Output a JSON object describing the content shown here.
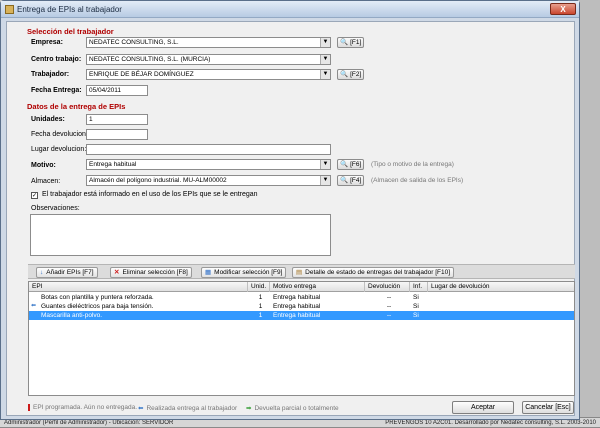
{
  "window": {
    "title": "Entrega de EPIs al trabajador",
    "close_label": "X"
  },
  "trabajador_section": {
    "title": "Selección del trabajador",
    "empresa_label": "Empresa:",
    "empresa_value": "NEDATEC CONSULTING, S.L.",
    "empresa_key": "[F1]",
    "centro_label": "Centro trabajo:",
    "centro_value": "NEDATEC CONSULTING, S.L. (MURCIA)",
    "trabajador_label": "Trabajador:",
    "trabajador_value": "ENRIQUE DE BÉJAR DOMÍNGUEZ",
    "trabajador_key": "[F2]",
    "fecha_label": "Fecha Entrega:",
    "fecha_value": "05/04/2011"
  },
  "entrega_section": {
    "title": "Datos de la entrega de EPIs",
    "unidades_label": "Unidades:",
    "unidades_value": "1",
    "fecha_dev_label": "Fecha devolucion:",
    "fecha_dev_value": "",
    "lugar_dev_label": "Lugar devolucion:",
    "lugar_dev_value": "",
    "motivo_label": "Motivo:",
    "motivo_value": "Entrega habitual",
    "motivo_key": "[F6]",
    "motivo_hint": "(Tipo o motivo de la entrega)",
    "almacen_label": "Almacen:",
    "almacen_value": "Almacén del polígono industrial. MU-ALM00002",
    "almacen_key": "[F4]",
    "almacen_hint": "(Almacen de salida de los EPIs)",
    "informado_label": "El trabajador está informado en el uso de los EPIs que se le entregan",
    "observaciones_label": "Observaciones:"
  },
  "toolbar": {
    "add_label": "Añadir EPIs [F7]",
    "remove_label": "Eliminar selección [F8]",
    "modify_label": "Modificar selección [F9]",
    "detail_label": "Detalle de estado de entregas del trabajador [F10]"
  },
  "grid": {
    "columns": [
      "EPI",
      "Unid.",
      "Motivo entrega",
      "Devolución",
      "Inf.",
      "Lugar de devolución"
    ],
    "rows": [
      {
        "epi": "Botas con plantilla y puntera reforzada.",
        "unid": "1",
        "motivo": "Entrega habitual",
        "devolucion": "--",
        "inf": "Si",
        "lugar": ""
      },
      {
        "epi": "Guantes dieléctricos para baja tensión.",
        "unid": "1",
        "motivo": "Entrega habitual",
        "devolucion": "--",
        "inf": "Si",
        "lugar": ""
      },
      {
        "epi": "Mascarilla anti-polvo.",
        "unid": "1",
        "motivo": "Entrega habitual",
        "devolucion": "--",
        "inf": "Si",
        "lugar": ""
      }
    ]
  },
  "footer": {
    "legend_1": "EPI programada. Aún no entregada.",
    "legend_2": "Realizada entrega al trabajador",
    "legend_3": "Devuelta parcial o totalmente",
    "accept_label": "Aceptar",
    "cancel_label": "Cancelar [Esc]"
  },
  "background": {
    "status_left": "Administrador   (Perfil de Administrador)  -  Ubicación: SERVIDOR",
    "status_right": "PREVENGOS 10 A2C01. Desarrollado por Nedatec consulting, S.L. 2003-2010"
  },
  "colors": {
    "section_title": "#b00000",
    "selection": "#3399ff",
    "window_frame": "#cfd9e6"
  }
}
